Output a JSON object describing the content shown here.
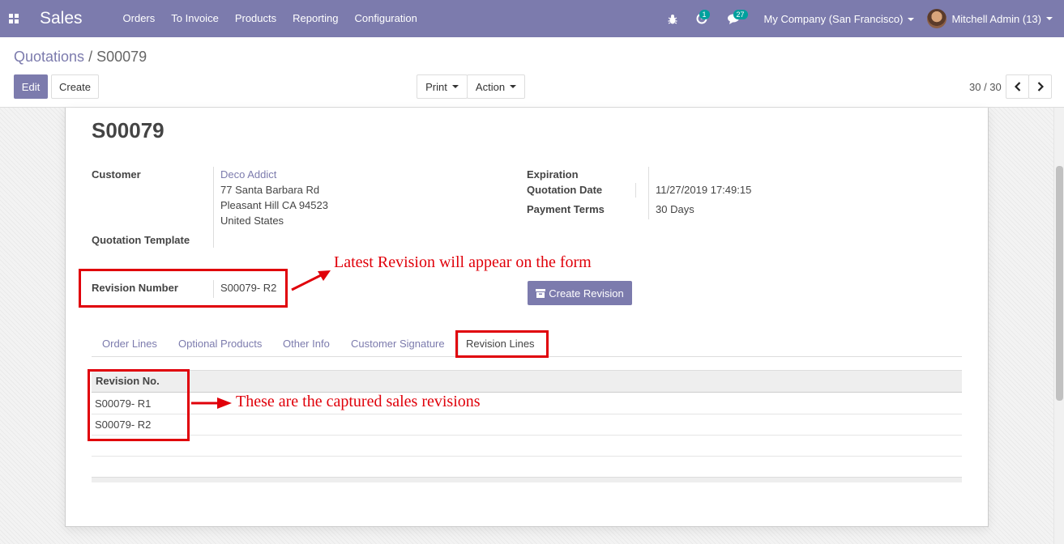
{
  "navbar": {
    "brand": "Sales",
    "menu": [
      "Orders",
      "To Invoice",
      "Products",
      "Reporting",
      "Configuration"
    ],
    "activity_count": "1",
    "messages_count": "27",
    "company": "My Company (San Francisco)",
    "user": "Mitchell Admin (13)"
  },
  "breadcrumb": {
    "parent": "Quotations",
    "separator": "/",
    "current": "S00079"
  },
  "toolbar": {
    "edit": "Edit",
    "create": "Create",
    "print": "Print",
    "action": "Action",
    "pager": "30 / 30"
  },
  "form": {
    "name": "S00079",
    "customer_label": "Customer",
    "customer_name": "Deco Addict",
    "address": [
      "77 Santa Barbara Rd",
      "Pleasant Hill CA 94523",
      "United States"
    ],
    "quotation_template_label": "Quotation Template",
    "expiration_label": "Expiration",
    "quotation_date_label": "Quotation Date",
    "quotation_date": "11/27/2019 17:49:15",
    "payment_terms_label": "Payment Terms",
    "payment_terms": "30 Days",
    "revision_number_label": "Revision Number",
    "revision_number": "S00079- R2",
    "create_revision": "Create Revision"
  },
  "tabs": [
    "Order Lines",
    "Optional Products",
    "Other Info",
    "Customer Signature",
    "Revision Lines"
  ],
  "revision_table": {
    "header": "Revision No.",
    "rows": [
      "S00079- R1",
      "S00079- R2"
    ]
  },
  "annotations": {
    "latest": "Latest Revision will appear on the form",
    "captured": "These are the captured sales revisions"
  },
  "colors": {
    "brand": "#7c7bad",
    "annotation": "#e0000a",
    "badge": "#00a09d"
  }
}
